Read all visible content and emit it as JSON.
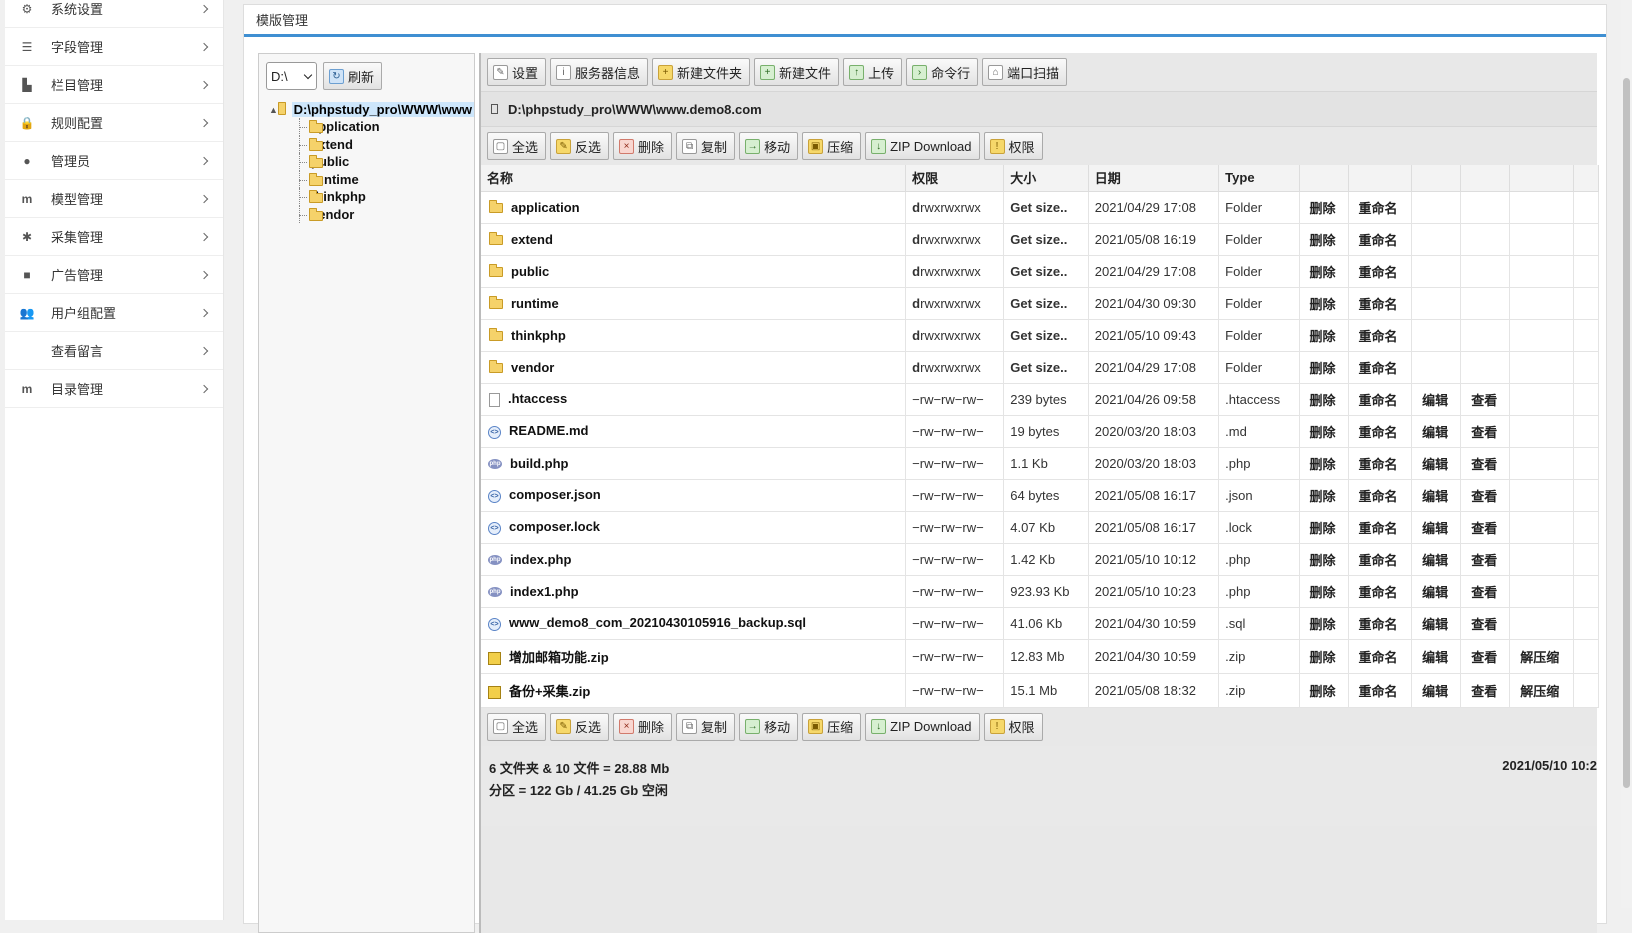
{
  "sidebar": {
    "items": [
      {
        "label": "系统设置",
        "icon": "gear-icon",
        "glyph": "⚙"
      },
      {
        "label": "字段管理",
        "icon": "list-icon",
        "glyph": "☰"
      },
      {
        "label": "栏目管理",
        "icon": "bar-chart-icon",
        "glyph": "▙"
      },
      {
        "label": "规则配置",
        "icon": "lock-icon",
        "glyph": "🔒"
      },
      {
        "label": "管理员",
        "icon": "user-icon",
        "glyph": "●"
      },
      {
        "label": "模型管理",
        "icon": "model-icon",
        "glyph": "m"
      },
      {
        "label": "采集管理",
        "icon": "bug-icon",
        "glyph": "✱"
      },
      {
        "label": "广告管理",
        "icon": "video-camera-icon",
        "glyph": "■"
      },
      {
        "label": "用户组配置",
        "icon": "users-icon",
        "glyph": "👥"
      },
      {
        "label": "查看留言",
        "icon": "",
        "glyph": ""
      },
      {
        "label": "目录管理",
        "icon": "model-icon",
        "glyph": "m"
      }
    ]
  },
  "panel": {
    "title": "模版管理"
  },
  "tree": {
    "drive": "D:\\",
    "refresh_label": "刷新",
    "root": "D:\\phpstudy_pro\\WWW\\www",
    "children": [
      "application",
      "extend",
      "public",
      "runtime",
      "thinkphp",
      "vendor"
    ]
  },
  "toolbar": {
    "settings": "设置",
    "server_info": "服务器信息",
    "new_folder": "新建文件夹",
    "new_file": "新建文件",
    "upload": "上传",
    "command": "命令行",
    "port_scan": "端口扫描"
  },
  "path": "D:\\phpstudy_pro\\WWW\\www.demo8.com",
  "actions": {
    "select_all": "全选",
    "invert": "反选",
    "delete": "删除",
    "copy": "复制",
    "move": "移动",
    "compress": "压缩",
    "zip_download": "ZIP Download",
    "permissions": "权限"
  },
  "table": {
    "headers": {
      "name": "名称",
      "perm": "权限",
      "size": "大小",
      "date": "日期",
      "type": "Type"
    },
    "row_actions": {
      "delete": "删除",
      "rename": "重命名",
      "edit": "编辑",
      "view": "查看",
      "extract": "解压缩"
    },
    "rows": [
      {
        "name": "application",
        "kind": "folder",
        "perm_first": "d",
        "perm": "rwxrwxrwx",
        "size": "Get size..",
        "date": "2021/04/29 17:08",
        "type": "Folder"
      },
      {
        "name": "extend",
        "kind": "folder",
        "perm_first": "d",
        "perm": "rwxrwxrwx",
        "size": "Get size..",
        "date": "2021/05/08 16:19",
        "type": "Folder"
      },
      {
        "name": "public",
        "kind": "folder",
        "perm_first": "d",
        "perm": "rwxrwxrwx",
        "size": "Get size..",
        "date": "2021/04/29 17:08",
        "type": "Folder"
      },
      {
        "name": "runtime",
        "kind": "folder",
        "perm_first": "d",
        "perm": "rwxrwxrwx",
        "size": "Get size..",
        "date": "2021/04/30 09:30",
        "type": "Folder"
      },
      {
        "name": "thinkphp",
        "kind": "folder",
        "perm_first": "d",
        "perm": "rwxrwxrwx",
        "size": "Get size..",
        "date": "2021/05/10 09:43",
        "type": "Folder"
      },
      {
        "name": "vendor",
        "kind": "folder",
        "perm_first": "d",
        "perm": "rwxrwxrwx",
        "size": "Get size..",
        "date": "2021/04/29 17:08",
        "type": "Folder"
      },
      {
        "name": ".htaccess",
        "kind": "doc",
        "perm_first": "",
        "perm": "−rw−rw−rw−",
        "size": "239 bytes",
        "date": "2021/04/26 09:58",
        "type": ".htaccess"
      },
      {
        "name": "README.md",
        "kind": "code",
        "perm_first": "",
        "perm": "−rw−rw−rw−",
        "size": "19 bytes",
        "date": "2020/03/20 18:03",
        "type": ".md"
      },
      {
        "name": "build.php",
        "kind": "php",
        "perm_first": "",
        "perm": "−rw−rw−rw−",
        "size": "1.1 Kb",
        "date": "2020/03/20 18:03",
        "type": ".php"
      },
      {
        "name": "composer.json",
        "kind": "code",
        "perm_first": "",
        "perm": "−rw−rw−rw−",
        "size": "64 bytes",
        "date": "2021/05/08 16:17",
        "type": ".json"
      },
      {
        "name": "composer.lock",
        "kind": "code",
        "perm_first": "",
        "perm": "−rw−rw−rw−",
        "size": "4.07 Kb",
        "date": "2021/05/08 16:17",
        "type": ".lock"
      },
      {
        "name": "index.php",
        "kind": "php",
        "perm_first": "",
        "perm": "−rw−rw−rw−",
        "size": "1.42 Kb",
        "date": "2021/05/10 10:12",
        "type": ".php"
      },
      {
        "name": "index1.php",
        "kind": "php",
        "perm_first": "",
        "perm": "−rw−rw−rw−",
        "size": "923.93 Kb",
        "date": "2021/05/10 10:23",
        "type": ".php"
      },
      {
        "name": "www_demo8_com_20210430105916_backup.sql",
        "kind": "code",
        "perm_first": "",
        "perm": "−rw−rw−rw−",
        "size": "41.06 Kb",
        "date": "2021/04/30 10:59",
        "type": ".sql"
      },
      {
        "name": "增加邮箱功能.zip",
        "kind": "zip",
        "perm_first": "",
        "perm": "−rw−rw−rw−",
        "size": "12.83 Mb",
        "date": "2021/04/30 10:59",
        "type": ".zip"
      },
      {
        "name": "备份+采集.zip",
        "kind": "zip",
        "perm_first": "",
        "perm": "−rw−rw−rw−",
        "size": "15.1 Mb",
        "date": "2021/05/08 18:32",
        "type": ".zip"
      }
    ]
  },
  "summary": {
    "line1": "6 文件夹 & 10 文件 = 28.88 Mb",
    "line2": "分区 = 122 Gb / 41.25 Gb 空闲",
    "time": "2021/05/10 10:2"
  }
}
